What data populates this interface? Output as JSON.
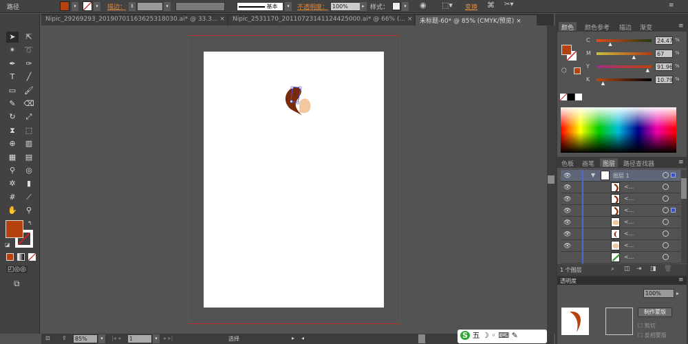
{
  "control_bar": {
    "selection_type": "路径",
    "fill_color": "#b5420f",
    "stroke_label": "描边：",
    "stroke_profile": "基本",
    "opacity_label": "不透明度：",
    "opacity_value": "100%",
    "style_label": "样式：",
    "transform_label": "变换"
  },
  "document_tabs": [
    {
      "label": "Nipic_29269293_20190701163625318030.ai* @ 33.3...",
      "close": "×",
      "active": false
    },
    {
      "label": "Nipic_2531170_20110723141124425000.ai* @ 66% (...",
      "close": "×",
      "active": false
    },
    {
      "label": "未标题-60* @ 85% (CMYK/预览)",
      "close": "×",
      "active": true
    }
  ],
  "tools": [
    "selection",
    "direct-selection",
    "magic-wand",
    "lasso",
    "pen",
    "curvature",
    "type",
    "line-segment",
    "rectangle",
    "paintbrush",
    "pencil",
    "eraser",
    "rotate",
    "scale",
    "width",
    "free-transform",
    "shape-builder",
    "perspective-grid",
    "mesh",
    "gradient",
    "eyedropper",
    "blend",
    "symbol-sprayer",
    "column-graph",
    "artboard",
    "slice",
    "hand",
    "zoom"
  ],
  "toolbox_colors": {
    "fill": "#b5420f",
    "stroke": "none"
  },
  "status_bar": {
    "zoom": "85%",
    "artboard_number": "1",
    "current_tool": "选择"
  },
  "color_panel": {
    "tabs": [
      "颜色",
      "颜色参考",
      "描边",
      "渐变"
    ],
    "active_tab": "颜色",
    "channels": [
      {
        "label": "C",
        "value": "24.47",
        "fraction": 0.24,
        "gradient": "linear-gradient(90deg,#e84a1a,#1e3a12)"
      },
      {
        "label": "M",
        "value": "67",
        "fraction": 0.67,
        "gradient": "linear-gradient(90deg,#c8c040,#b33a12)"
      },
      {
        "label": "Y",
        "value": "91.96",
        "fraction": 0.92,
        "gradient": "linear-gradient(90deg,#a03080,#c24010)"
      },
      {
        "label": "K",
        "value": "10.79",
        "fraction": 0.11,
        "gradient": "linear-gradient(90deg,#b84a14,#000)"
      }
    ]
  },
  "layers_panel": {
    "tabs": [
      "色板",
      "画笔",
      "图层",
      "路径查找器"
    ],
    "active_tab": "图层",
    "layer_name": "图层 1",
    "items": [
      {
        "name": "<...",
        "thumb": "brown-stroke"
      },
      {
        "name": "<...",
        "thumb": "brown-stroke"
      },
      {
        "name": "<...",
        "thumb": "brown-stroke",
        "selected": true
      },
      {
        "name": "<...",
        "thumb": "skin-shape"
      },
      {
        "name": "<...",
        "thumb": "hair-shape"
      },
      {
        "name": "<...",
        "thumb": "skin-shape"
      },
      {
        "name": "<...",
        "thumb": "green-stroke"
      }
    ],
    "footer_count": "1 个图层"
  },
  "transparency_panel": {
    "title": "透明度",
    "opacity": "100%",
    "make_mask_button": "制作蒙版",
    "clip_label": "剪切",
    "invert_mask_label": "反相蒙版"
  },
  "ime_bar": {
    "label": "五"
  }
}
